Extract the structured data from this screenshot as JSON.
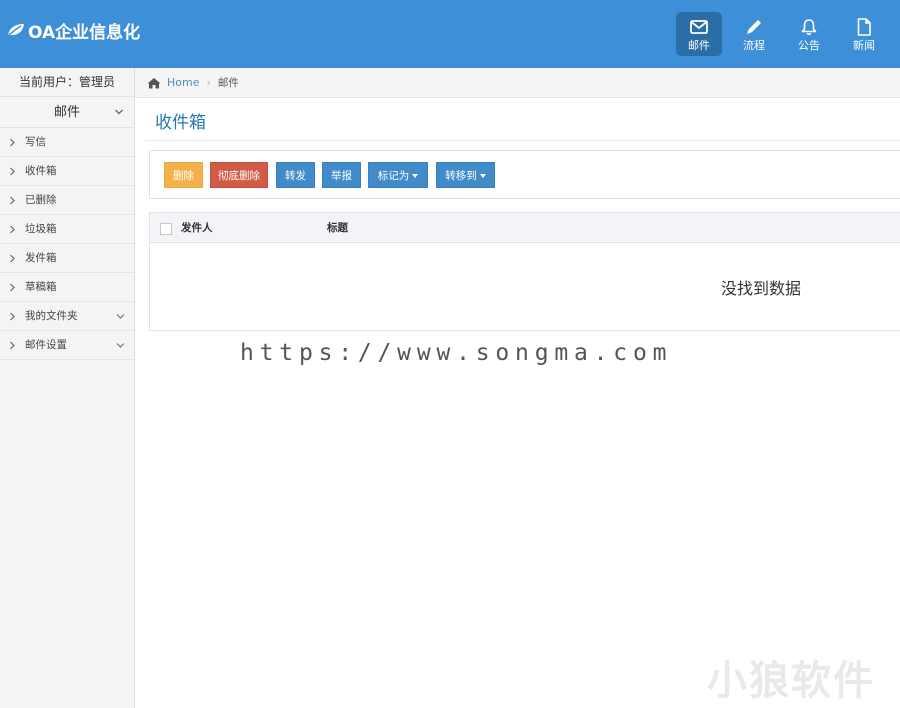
{
  "app": {
    "title": "OA企业信息化"
  },
  "topnav": [
    {
      "label": "邮件",
      "icon": "envelope-icon",
      "active": true
    },
    {
      "label": "流程",
      "icon": "pencil-icon",
      "active": false
    },
    {
      "label": "公告",
      "icon": "bell-icon",
      "active": false
    },
    {
      "label": "新闻",
      "icon": "file-icon",
      "active": false
    }
  ],
  "sidebar": {
    "current_user": "当前用户：管理员",
    "section": "邮件",
    "items": [
      {
        "label": "写信",
        "has_submenu": false
      },
      {
        "label": "收件箱",
        "has_submenu": false
      },
      {
        "label": "已删除",
        "has_submenu": false
      },
      {
        "label": "垃圾箱",
        "has_submenu": false
      },
      {
        "label": "发件箱",
        "has_submenu": false
      },
      {
        "label": "草稿箱",
        "has_submenu": false
      },
      {
        "label": "我的文件夹",
        "has_submenu": true
      },
      {
        "label": "邮件设置",
        "has_submenu": true
      }
    ]
  },
  "breadcrumb": {
    "home": "Home",
    "separator": "›",
    "current": "邮件"
  },
  "page": {
    "title": "收件箱"
  },
  "toolbar": {
    "delete": "删除",
    "purge": "彻底删除",
    "forward": "转发",
    "report": "举报",
    "mark_as": "标记为",
    "move_to": "转移到"
  },
  "grid": {
    "columns": [
      "发件人",
      "标题"
    ],
    "empty_text": "没找到数据"
  },
  "watermark": {
    "url": "https://www.songma.com",
    "brand": "小狼软件"
  },
  "colors": {
    "header": "#3d8fd8",
    "header_active": "#2b6ea7",
    "link": "#4c8fbd",
    "btn_yellow": "#f3b14c",
    "btn_red": "#d15b47",
    "btn_blue": "#428bca"
  }
}
